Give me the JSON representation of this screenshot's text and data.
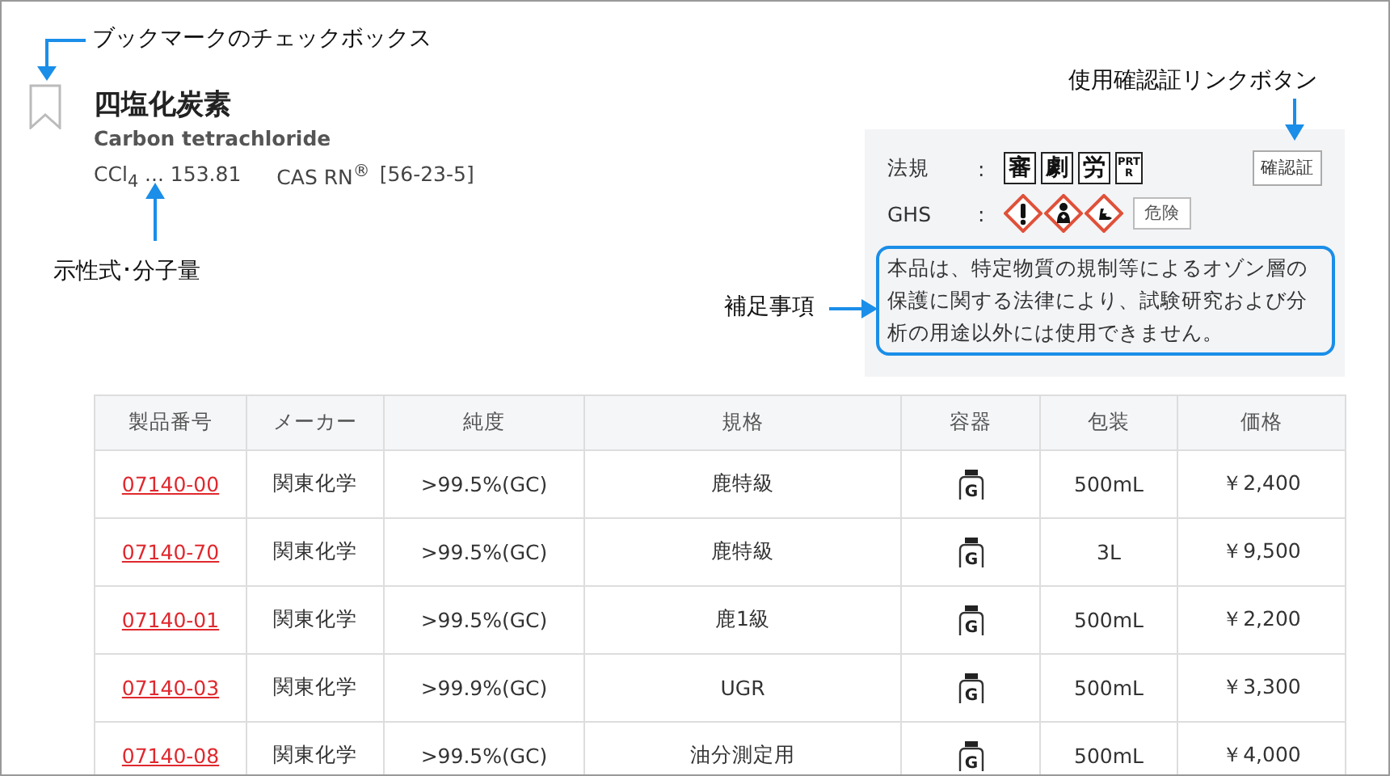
{
  "product": {
    "bookmarked": false,
    "name_ja": "四塩化炭素",
    "name_en": "Carbon tetrachloride",
    "formula": "CCl$_{4}$ ... 153.81",
    "cas_label": "CAS RN$^{®}$",
    "cas_number": "[56-23-5]"
  },
  "regulations": {
    "label": "法規",
    "separator": ":",
    "badges": [
      {
        "text": "審",
        "kind": "kanji"
      },
      {
        "text": "劇",
        "kind": "kanji"
      },
      {
        "text": "労",
        "kind": "kanji"
      },
      {
        "text": "PRTR",
        "kind": "small"
      }
    ],
    "confirm_button": "確認証"
  },
  "ghs": {
    "label": "GHS",
    "separator": ":",
    "pictograms": [
      {
        "kind": "exclamation"
      },
      {
        "kind": "health"
      },
      {
        "kind": "environment"
      }
    ],
    "signal_word": "危険"
  },
  "note": "本品は、特定物質の規制等によるオゾン層の保護に関する法律により、試験研究および分析の用途以外には使用できません。",
  "table": {
    "columns": [
      "製品番号",
      "メーカー",
      "純度",
      "規格",
      "容器",
      "包装",
      "価格"
    ],
    "rows": [
      {
        "code": "07140-00",
        "maker": "関東化学",
        "purity": ">99.5%(GC)",
        "grade": "鹿特級",
        "container": "G",
        "package": "500mL",
        "price": "￥2,400"
      },
      {
        "code": "07140-70",
        "maker": "関東化学",
        "purity": ">99.5%(GC)",
        "grade": "鹿特級",
        "container": "G",
        "package": "3L",
        "price": "￥9,500"
      },
      {
        "code": "07140-01",
        "maker": "関東化学",
        "purity": ">99.5%(GC)",
        "grade": "鹿1級",
        "container": "G",
        "package": "500mL",
        "price": "￥2,200"
      },
      {
        "code": "07140-03",
        "maker": "関東化学",
        "purity": ">99.9%(GC)",
        "grade": "UGR",
        "container": "G",
        "package": "500mL",
        "price": "￥3,300"
      },
      {
        "code": "07140-08",
        "maker": "関東化学",
        "purity": ">99.5%(GC)",
        "grade": "油分測定用",
        "container": "G",
        "package": "500mL",
        "price": "￥4,000"
      }
    ]
  },
  "annotations": {
    "bookmark": "ブックマークのチェックボックス",
    "formula": "示性式･分子量",
    "note": "補足事項",
    "confirm_button": "使用確認証リンクボタン"
  }
}
